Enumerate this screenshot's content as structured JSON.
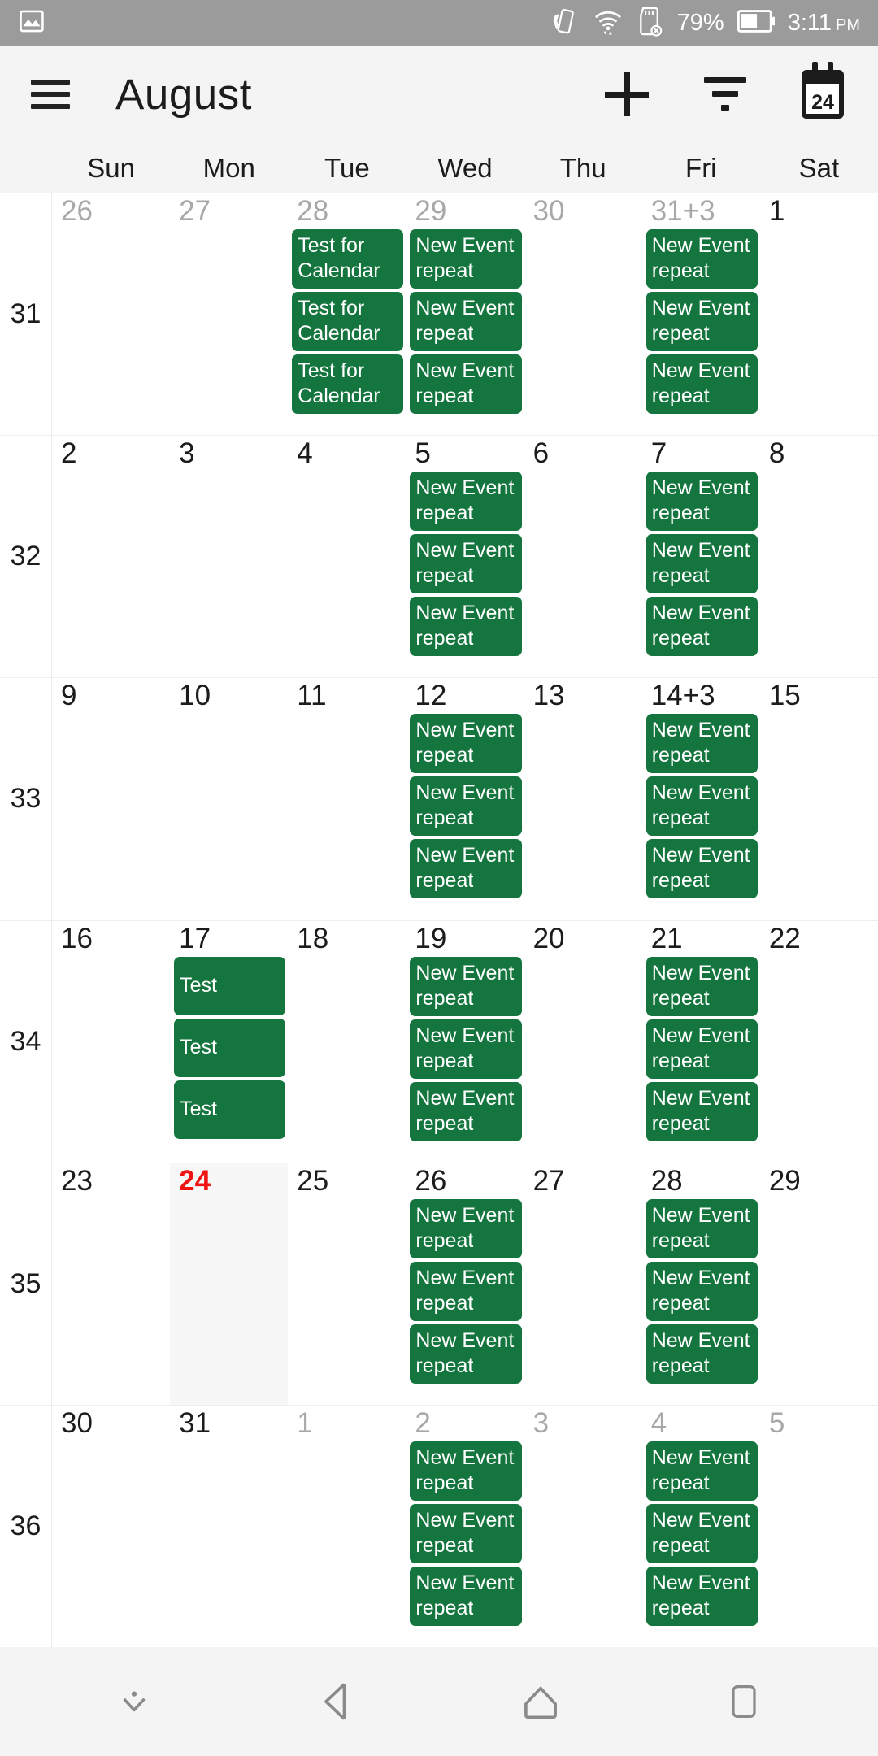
{
  "status_bar": {
    "left_icons": [
      "image-gallery-icon"
    ],
    "right_icons": [
      "screen-rotate-icon",
      "wifi-icon",
      "sd-card-off-icon",
      "battery-icon"
    ],
    "battery_percent": "79%",
    "time": "3:11",
    "meridiem": "PM"
  },
  "toolbar": {
    "menu_icon": "hamburger-menu-icon",
    "title": "August",
    "add_icon": "plus-icon",
    "filter_icon": "filter-icon",
    "today_icon": "calendar-today-icon",
    "today_icon_number": "24"
  },
  "weekday_headers": [
    "Sun",
    "Mon",
    "Tue",
    "Wed",
    "Thu",
    "Fri",
    "Sat"
  ],
  "colors": {
    "event_green": "#15753f",
    "today_red": "#ef1313",
    "toolbar_bg": "#f4f4f4",
    "statusbar_bg": "#9b9b9b",
    "other_month_text": "#a8a8a8",
    "today_cell_bg": "#f7f7f7"
  },
  "weeks": [
    {
      "week_number": "31",
      "days": [
        {
          "label": "26",
          "other_month": true,
          "today": false,
          "events": []
        },
        {
          "label": "27",
          "other_month": true,
          "today": false,
          "events": []
        },
        {
          "label": "28",
          "other_month": true,
          "today": false,
          "events": [
            "Test for Calendar",
            "Test for Calendar",
            "Test for Calendar"
          ]
        },
        {
          "label": "29",
          "other_month": true,
          "today": false,
          "events": [
            "New Event repeat",
            "New Event repeat",
            "New Event repeat"
          ]
        },
        {
          "label": "30",
          "other_month": true,
          "today": false,
          "events": []
        },
        {
          "label": "31+3",
          "other_month": true,
          "today": false,
          "events": [
            "New Event repeat",
            "New Event repeat",
            "New Event repeat"
          ]
        },
        {
          "label": "1",
          "other_month": false,
          "today": false,
          "events": []
        }
      ]
    },
    {
      "week_number": "32",
      "days": [
        {
          "label": "2",
          "other_month": false,
          "today": false,
          "events": []
        },
        {
          "label": "3",
          "other_month": false,
          "today": false,
          "events": []
        },
        {
          "label": "4",
          "other_month": false,
          "today": false,
          "events": []
        },
        {
          "label": "5",
          "other_month": false,
          "today": false,
          "events": [
            "New Event repeat",
            "New Event repeat",
            "New Event repeat"
          ]
        },
        {
          "label": "6",
          "other_month": false,
          "today": false,
          "events": []
        },
        {
          "label": "7",
          "other_month": false,
          "today": false,
          "events": [
            "New Event repeat",
            "New Event repeat",
            "New Event repeat"
          ]
        },
        {
          "label": "8",
          "other_month": false,
          "today": false,
          "events": []
        }
      ]
    },
    {
      "week_number": "33",
      "days": [
        {
          "label": "9",
          "other_month": false,
          "today": false,
          "events": []
        },
        {
          "label": "10",
          "other_month": false,
          "today": false,
          "events": []
        },
        {
          "label": "11",
          "other_month": false,
          "today": false,
          "events": []
        },
        {
          "label": "12",
          "other_month": false,
          "today": false,
          "events": [
            "New Event repeat",
            "New Event repeat",
            "New Event repeat"
          ]
        },
        {
          "label": "13",
          "other_month": false,
          "today": false,
          "events": []
        },
        {
          "label": "14+3",
          "other_month": false,
          "today": false,
          "events": [
            "New Event repeat",
            "New Event repeat",
            "New Event repeat"
          ]
        },
        {
          "label": "15",
          "other_month": false,
          "today": false,
          "events": []
        }
      ]
    },
    {
      "week_number": "34",
      "days": [
        {
          "label": "16",
          "other_month": false,
          "today": false,
          "events": []
        },
        {
          "label": "17",
          "other_month": false,
          "today": false,
          "events": [
            "Test",
            "Test",
            "Test"
          ],
          "center_text": true
        },
        {
          "label": "18",
          "other_month": false,
          "today": false,
          "events": []
        },
        {
          "label": "19",
          "other_month": false,
          "today": false,
          "events": [
            "New Event repeat",
            "New Event repeat",
            "New Event repeat"
          ]
        },
        {
          "label": "20",
          "other_month": false,
          "today": false,
          "events": []
        },
        {
          "label": "21",
          "other_month": false,
          "today": false,
          "events": [
            "New Event repeat",
            "New Event repeat",
            "New Event repeat"
          ]
        },
        {
          "label": "22",
          "other_month": false,
          "today": false,
          "events": []
        }
      ]
    },
    {
      "week_number": "35",
      "days": [
        {
          "label": "23",
          "other_month": false,
          "today": false,
          "events": []
        },
        {
          "label": "24",
          "other_month": false,
          "today": true,
          "events": []
        },
        {
          "label": "25",
          "other_month": false,
          "today": false,
          "events": []
        },
        {
          "label": "26",
          "other_month": false,
          "today": false,
          "events": [
            "New Event repeat",
            "New Event repeat",
            "New Event repeat"
          ]
        },
        {
          "label": "27",
          "other_month": false,
          "today": false,
          "events": []
        },
        {
          "label": "28",
          "other_month": false,
          "today": false,
          "events": [
            "New Event repeat",
            "New Event repeat",
            "New Event repeat"
          ]
        },
        {
          "label": "29",
          "other_month": false,
          "today": false,
          "events": []
        }
      ]
    },
    {
      "week_number": "36",
      "days": [
        {
          "label": "30",
          "other_month": false,
          "today": false,
          "events": []
        },
        {
          "label": "31",
          "other_month": false,
          "today": false,
          "events": []
        },
        {
          "label": "1",
          "other_month": true,
          "today": false,
          "events": []
        },
        {
          "label": "2",
          "other_month": true,
          "today": false,
          "events": [
            "New Event repeat",
            "New Event repeat",
            "New Event repeat"
          ]
        },
        {
          "label": "3",
          "other_month": true,
          "today": false,
          "events": []
        },
        {
          "label": "4",
          "other_month": true,
          "today": false,
          "events": [
            "New Event repeat",
            "New Event repeat",
            "New Event repeat"
          ]
        },
        {
          "label": "5",
          "other_month": true,
          "today": false,
          "events": []
        }
      ]
    }
  ],
  "nav_bar": {
    "buttons": [
      "hide-navbar-icon",
      "back-icon",
      "home-icon",
      "recents-icon"
    ]
  }
}
